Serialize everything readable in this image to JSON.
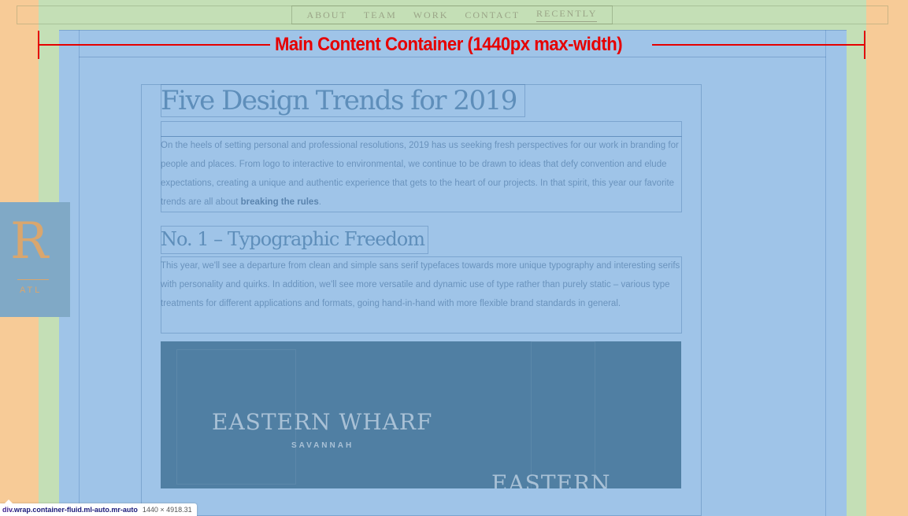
{
  "nav": {
    "items": [
      "ABOUT",
      "TEAM",
      "WORK",
      "CONTACT",
      "RECENTLY"
    ],
    "active": "RECENTLY"
  },
  "annotation": {
    "label": "Main Content Container (1440px max-width)",
    "color": "#e60000"
  },
  "logo": {
    "letter": "R",
    "sub": "ATL"
  },
  "article": {
    "title": "Five Design Trends for 2019",
    "intro_text": "On the heels of setting personal and professional resolutions, 2019 has us seeking fresh perspectives for our work in branding for people and places. From logo to interactive to environmental, we continue to be drawn to ideas that defy convention and elude expectations, creating a unique and authentic experience that gets to the heart of our projects. In that spirit, this year our favorite trends are all about ",
    "intro_bold": "breaking the rules",
    "intro_end": ".",
    "section_title": "No. 1 – Typographic Freedom",
    "section_text": "This year, we'll see a departure from clean and simple sans serif typefaces towards more unique typography and interesting serifs with personality and quirks. In addition, we'll see more versatile and dynamic use of type rather than purely static – various type treatments for different applications and formats, going hand-in-hand with more flexible brand standards in general.",
    "hero": {
      "brand": "EASTERN WHARF",
      "city": "SAVANNAH",
      "brand_repeat": "EASTERN"
    }
  },
  "devtools": {
    "selector_tag": "div",
    "selector_classes": ".wrap.container-fluid.ml-auto.mr-auto",
    "dimensions": "1440 × 4918.31"
  },
  "colors": {
    "margin": "#f7cb97",
    "padding": "#c4dfb6",
    "content": "#9fc4e8"
  }
}
